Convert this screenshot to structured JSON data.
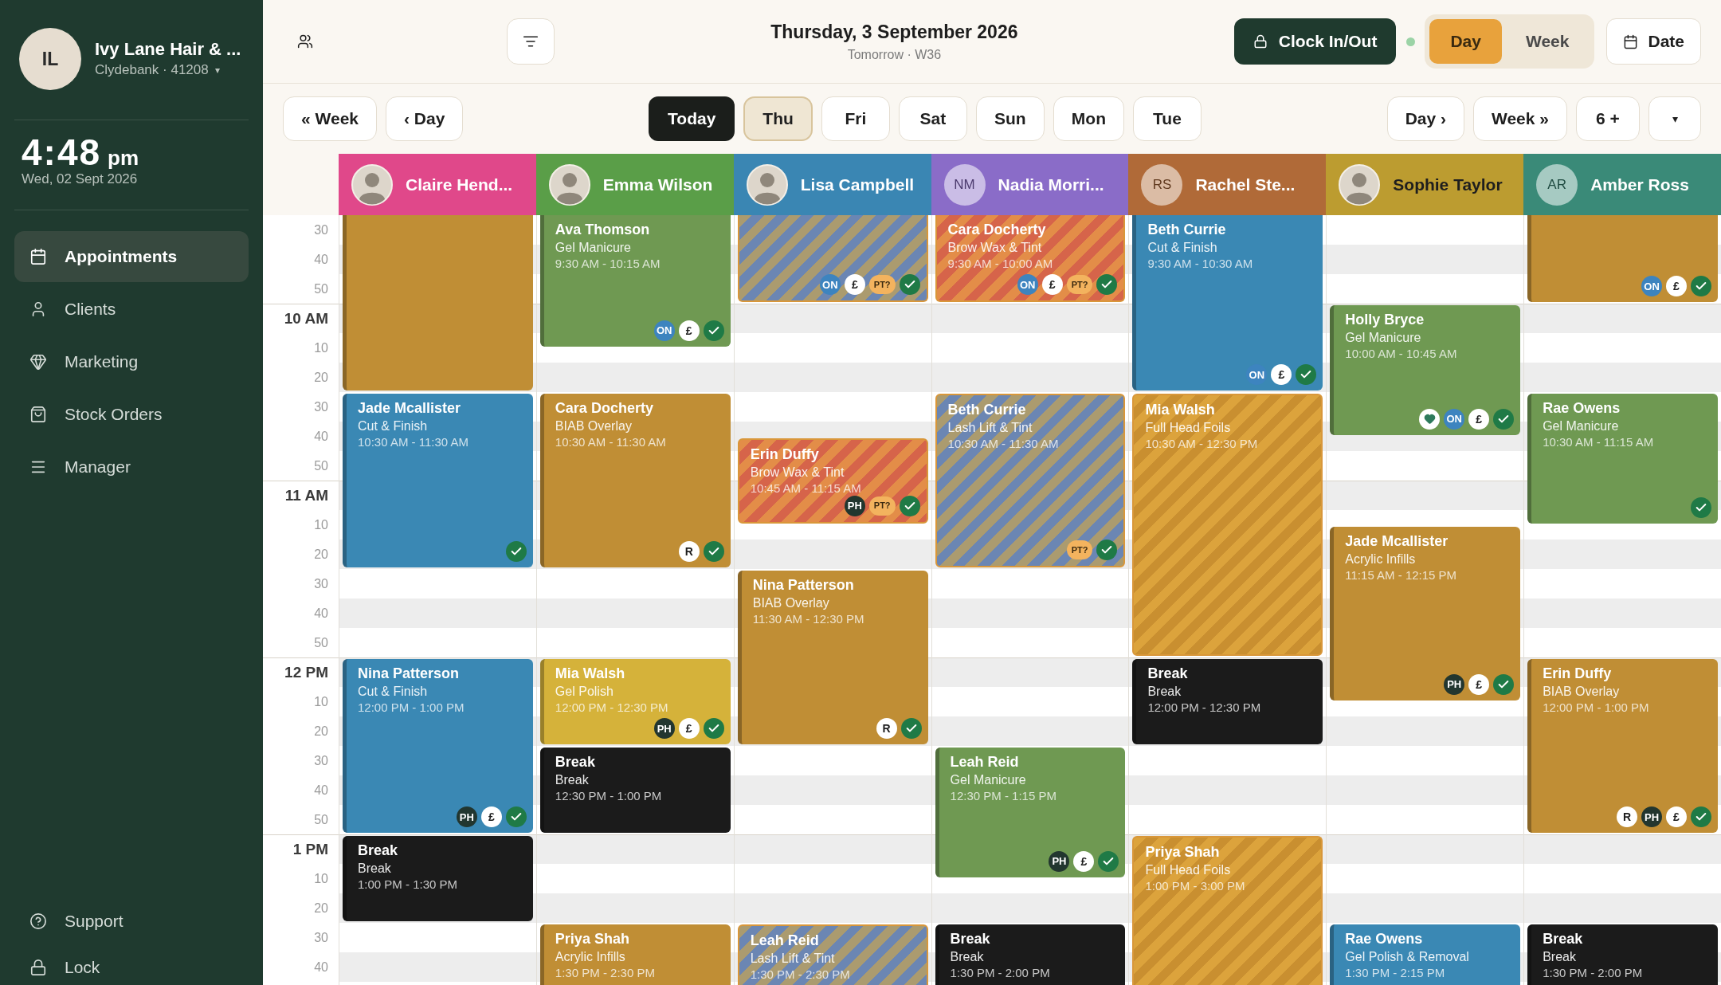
{
  "sidebar": {
    "business": {
      "initials": "IL",
      "name": "Ivy Lane Hair & ...",
      "location": "Clydebank · 41208",
      "caret": "▾"
    },
    "clock": {
      "time": "4:48",
      "period": "pm",
      "date": "Wed, 02 Sept 2026"
    },
    "nav": [
      {
        "label": "Appointments",
        "selected": true
      },
      {
        "label": "Clients",
        "selected": false
      },
      {
        "label": "Marketing",
        "selected": false
      },
      {
        "label": "Stock Orders",
        "selected": false
      },
      {
        "label": "Manager",
        "selected": false
      }
    ],
    "footer": [
      {
        "label": "Support"
      },
      {
        "label": "Lock"
      }
    ]
  },
  "header": {
    "title": "Thursday, 3 September 2026",
    "subtitle": "Tomorrow · W36",
    "clock_button": "Clock In/Out",
    "clock_indicator": {
      "on": true
    },
    "view_toggle": [
      {
        "label": "Day",
        "selected": true
      },
      {
        "label": "Week",
        "selected": false
      }
    ],
    "date_button": "Date"
  },
  "date_nav": {
    "back": [
      "« Week",
      "‹ Day"
    ],
    "today": "Today",
    "days": [
      {
        "label": "Thu",
        "selected": true
      },
      {
        "label": "Fri",
        "selected": false
      },
      {
        "label": "Sat",
        "selected": false
      },
      {
        "label": "Sun",
        "selected": false
      },
      {
        "label": "Mon",
        "selected": false
      },
      {
        "label": "Tue",
        "selected": false
      }
    ],
    "forward": [
      "Day ›",
      "Week »",
      "6 +"
    ],
    "menu": "▾"
  },
  "time_labels": [
    {
      "label": "30",
      "kind": "minute"
    },
    {
      "label": "40",
      "kind": "minute"
    },
    {
      "label": "50",
      "kind": "minute"
    },
    {
      "label": "10 AM",
      "kind": "hour"
    },
    {
      "label": "10",
      "kind": "minute"
    },
    {
      "label": "20",
      "kind": "minute"
    },
    {
      "label": "30",
      "kind": "minute"
    },
    {
      "label": "40",
      "kind": "minute"
    },
    {
      "label": "50",
      "kind": "minute"
    },
    {
      "label": "11 AM",
      "kind": "hour"
    },
    {
      "label": "10",
      "kind": "minute"
    },
    {
      "label": "20",
      "kind": "minute"
    },
    {
      "label": "30",
      "kind": "minute"
    },
    {
      "label": "40",
      "kind": "minute"
    },
    {
      "label": "50",
      "kind": "minute"
    },
    {
      "label": "12 PM",
      "kind": "hour"
    },
    {
      "label": "10",
      "kind": "minute"
    },
    {
      "label": "20",
      "kind": "minute"
    },
    {
      "label": "30",
      "kind": "minute"
    },
    {
      "label": "40",
      "kind": "minute"
    },
    {
      "label": "50",
      "kind": "minute"
    },
    {
      "label": "1 PM",
      "kind": "hour"
    },
    {
      "label": "10",
      "kind": "minute"
    },
    {
      "label": "20",
      "kind": "minute"
    },
    {
      "label": "30",
      "kind": "minute"
    },
    {
      "label": "40",
      "kind": "minute"
    }
  ],
  "staff": [
    {
      "name": "Claire Hend...",
      "color": "#e0488a",
      "avatar": {
        "kind": "photo"
      },
      "appointments": [
        {
          "kind": "tail_hour",
          "color": "#c08e35"
        },
        {
          "kind": "card",
          "title": "Jade Mcallister",
          "service": "Cut & Finish",
          "time": "10:30 AM - 11:30 AM",
          "color": "#3a88b4",
          "badges": [
            {
              "kind": "tick"
            }
          ]
        },
        {
          "kind": "card",
          "title": "Nina Patterson",
          "service": "Cut & Finish",
          "time": "12:00 PM - 1:00 PM",
          "color": "#3a88b4",
          "badges": [
            {
              "kind": "dark",
              "label": "PH"
            },
            {
              "kind": "light",
              "label": "£"
            },
            {
              "kind": "tick"
            }
          ]
        },
        {
          "kind": "card",
          "title": "Break",
          "service": "Break",
          "time": "1:00 PM - 1:30 PM",
          "color": "#1b1b1b"
        }
      ]
    },
    {
      "name": "Emma Wilson",
      "color": "#5a9e48",
      "avatar": {
        "kind": "photo"
      },
      "appointments": [
        {
          "kind": "card",
          "title": "Ava Thomson",
          "service": "Gel Manicure",
          "time": "9:30 AM - 10:15 AM",
          "color": "#6f9952",
          "badges": [
            {
              "kind": "blue",
              "label": "ON"
            },
            {
              "kind": "light",
              "label": "£"
            },
            {
              "kind": "tick"
            }
          ]
        },
        {
          "kind": "card",
          "title": "Cara Docherty",
          "service": "BIAB Overlay",
          "time": "10:30 AM - 11:30 AM",
          "color": "#c08e35",
          "badges": [
            {
              "kind": "light",
              "label": "R"
            },
            {
              "kind": "tick"
            }
          ]
        },
        {
          "kind": "card",
          "title": "Mia Walsh",
          "service": "Gel Polish",
          "time": "12:00 PM - 12:30 PM",
          "color": "#d5b23a",
          "badges": [
            {
              "kind": "dark",
              "label": "PH"
            },
            {
              "kind": "light",
              "label": "£"
            },
            {
              "kind": "tick"
            }
          ]
        },
        {
          "kind": "card",
          "title": "Break",
          "service": "Break",
          "time": "12:30 PM - 1:00 PM",
          "color": "#1b1b1b"
        },
        {
          "kind": "card",
          "title": "Priya Shah",
          "service": "Acrylic Infills",
          "time": "1:30 PM - 2:30 PM",
          "color": "#c08e35"
        }
      ]
    },
    {
      "name": "Lisa Campbell",
      "color": "#3a86b3",
      "avatar": {
        "kind": "photo"
      },
      "appointments": [
        {
          "kind": "tail_half",
          "color": "#ab9b6f",
          "stripes": {
            "color": "#6b86b3"
          },
          "badges": [
            {
              "kind": "blue",
              "label": "ON"
            },
            {
              "kind": "light",
              "label": "£"
            },
            {
              "kind": "peach",
              "label": "PT?"
            },
            {
              "kind": "tick"
            }
          ]
        },
        {
          "kind": "card",
          "title": "Erin Duffy",
          "service": "Brow Wax & Tint",
          "time": "10:45 AM - 11:15 AM",
          "color": "#e38d48",
          "stripes": {
            "color": "#d6644a"
          },
          "badges": [
            {
              "kind": "dark",
              "label": "PH"
            },
            {
              "kind": "peach",
              "label": "PT?"
            },
            {
              "kind": "tick"
            }
          ]
        },
        {
          "kind": "card",
          "title": "Nina Patterson",
          "service": "BIAB Overlay",
          "time": "11:30 AM - 12:30 PM",
          "color": "#c08e35",
          "badges": [
            {
              "kind": "light",
              "label": "R"
            },
            {
              "kind": "tick"
            }
          ]
        },
        {
          "kind": "card",
          "title": "Leah Reid",
          "service": "Lash Lift & Tint",
          "time": "1:30 PM - 2:30 PM",
          "color": "#ab9b6f",
          "stripes": {
            "color": "#6b86b3"
          }
        }
      ]
    },
    {
      "name": "Nadia Morri...",
      "color": "#8a6cc8",
      "avatar": {
        "kind": "initials",
        "initials": "NM"
      },
      "appointments": [
        {
          "kind": "card",
          "title": "Cara Docherty",
          "service": "Brow Wax & Tint",
          "time": "9:30 AM - 10:00 AM",
          "color": "#e38d48",
          "stripes": {
            "color": "#d6644a"
          },
          "badges": [
            {
              "kind": "blue",
              "label": "ON"
            },
            {
              "kind": "light",
              "label": "£"
            },
            {
              "kind": "peach",
              "label": "PT?"
            },
            {
              "kind": "tick"
            }
          ]
        },
        {
          "kind": "card",
          "title": "Beth Currie",
          "service": "Lash Lift & Tint",
          "time": "10:30 AM - 11:30 AM",
          "color": "#ab9b6f",
          "stripes": {
            "color": "#6b86b3"
          },
          "badges": [
            {
              "kind": "peach",
              "label": "PT?"
            },
            {
              "kind": "tick"
            }
          ]
        },
        {
          "kind": "card",
          "title": "Leah Reid",
          "service": "Gel Manicure",
          "time": "12:30 PM - 1:15 PM",
          "color": "#6f9952",
          "badges": [
            {
              "kind": "dark",
              "label": "PH"
            },
            {
              "kind": "light",
              "label": "£"
            },
            {
              "kind": "tick"
            }
          ]
        },
        {
          "kind": "card",
          "title": "Break",
          "service": "Break",
          "time": "1:30 PM - 2:00 PM",
          "color": "#1b1b1b"
        }
      ]
    },
    {
      "name": "Rachel Ste...",
      "color": "#b06a38",
      "avatar": {
        "kind": "initials",
        "initials": "RS"
      },
      "appointments": [
        {
          "kind": "card",
          "title": "Beth Currie",
          "service": "Cut & Finish",
          "time": "9:30 AM - 10:30 AM",
          "color": "#3a88b4",
          "badges": [
            {
              "kind": "blue",
              "label": "ON"
            },
            {
              "kind": "light",
              "label": "£"
            },
            {
              "kind": "tick"
            }
          ]
        },
        {
          "kind": "card",
          "title": "Mia Walsh",
          "service": "Full Head Foils",
          "time": "10:30 AM - 12:30 PM",
          "color": "#dca33c",
          "stripes": {
            "color": "#c98f30"
          }
        },
        {
          "kind": "card",
          "title": "Break",
          "service": "Break",
          "time": "12:00 PM - 12:30 PM",
          "color": "#1b1b1b"
        },
        {
          "kind": "card",
          "title": "Priya Shah",
          "service": "Full Head Foils",
          "time": "1:00 PM - 3:00 PM",
          "color": "#dca33c",
          "stripes": {
            "color": "#c98f30"
          }
        }
      ]
    },
    {
      "name": "Sophie Taylor",
      "color": "#bc9c30",
      "avatar": {
        "kind": "photo"
      },
      "appointments": [
        {
          "kind": "card",
          "title": "Holly Bryce",
          "service": "Gel Manicure",
          "time": "10:00 AM - 10:45 AM",
          "color": "#6f9952",
          "badges": [
            {
              "kind": "heart"
            },
            {
              "kind": "blue",
              "label": "ON"
            },
            {
              "kind": "light",
              "label": "£"
            },
            {
              "kind": "tick"
            }
          ]
        },
        {
          "kind": "card",
          "title": "Jade Mcallister",
          "service": "Acrylic Infills",
          "time": "11:15 AM - 12:15 PM",
          "color": "#c08e35",
          "badges": [
            {
              "kind": "dark",
              "label": "PH"
            },
            {
              "kind": "light",
              "label": "£"
            },
            {
              "kind": "tick"
            }
          ]
        },
        {
          "kind": "card",
          "title": "Rae Owens",
          "service": "Gel Polish & Removal",
          "time": "1:30 PM - 2:15 PM",
          "color": "#3a88b4"
        }
      ]
    },
    {
      "name": "Amber Ross",
      "color": "#3a8a78",
      "avatar": {
        "kind": "initials",
        "initials": "AR"
      },
      "appointments": [
        {
          "kind": "tail_half",
          "color": "#c08e35",
          "badges": [
            {
              "kind": "blue",
              "label": "ON"
            },
            {
              "kind": "light",
              "label": "£"
            },
            {
              "kind": "tick"
            }
          ]
        },
        {
          "kind": "card",
          "title": "Rae Owens",
          "service": "Gel Manicure",
          "time": "10:30 AM - 11:15 AM",
          "color": "#6f9952",
          "badges": [
            {
              "kind": "tick"
            }
          ]
        },
        {
          "kind": "card",
          "title": "Erin Duffy",
          "service": "BIAB Overlay",
          "time": "12:00 PM - 1:00 PM",
          "color": "#c08e35",
          "badges": [
            {
              "kind": "light",
              "label": "R"
            },
            {
              "kind": "dark",
              "label": "PH"
            },
            {
              "kind": "light",
              "label": "£"
            },
            {
              "kind": "tick"
            }
          ]
        },
        {
          "kind": "card",
          "title": "Break",
          "service": "Break",
          "time": "1:30 PM - 2:00 PM",
          "color": "#1b1b1b"
        }
      ]
    }
  ]
}
